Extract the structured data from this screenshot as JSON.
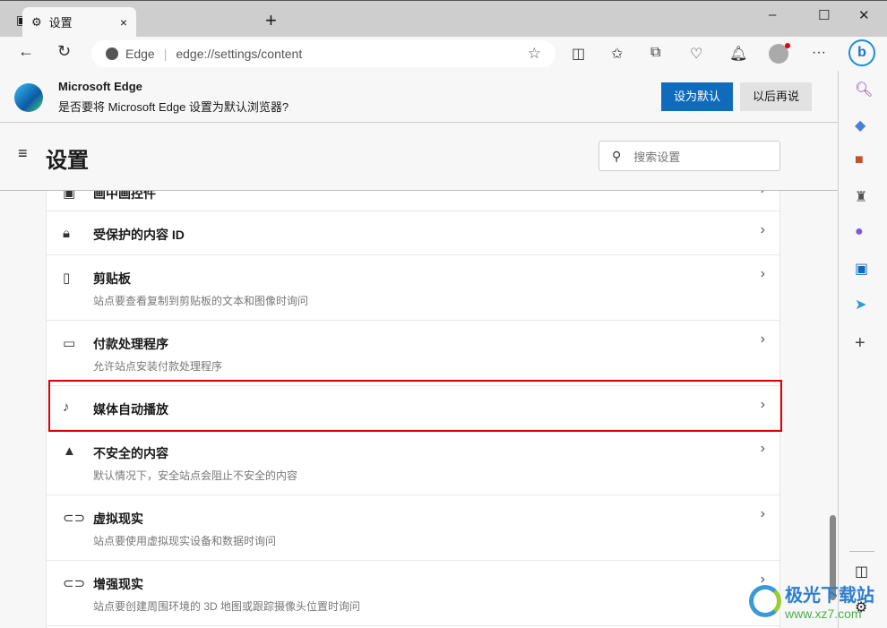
{
  "tab": {
    "title": "设置",
    "close": "×",
    "new": "+"
  },
  "window": {
    "min": "–",
    "max": "☐",
    "close": "✕"
  },
  "address": {
    "site": "Edge",
    "url": "edge://settings/content"
  },
  "banner": {
    "title": "Microsoft Edge",
    "message": "是否要将 Microsoft Edge 设置为默认浏览器?",
    "primary": "设为默认",
    "secondary": "以后再说",
    "accent": "#0f6cbd"
  },
  "header": {
    "title": "设置",
    "search_placeholder": "搜索设置"
  },
  "rows": [
    {
      "title": "画中画控件",
      "desc": ""
    },
    {
      "title": "受保护的内容 ID",
      "desc": ""
    },
    {
      "title": "剪贴板",
      "desc": "站点要查看复制到剪贴板的文本和图像时询问"
    },
    {
      "title": "付款处理程序",
      "desc": "允许站点安装付款处理程序"
    },
    {
      "title": "媒体自动播放",
      "desc": "",
      "highlighted": true
    },
    {
      "title": "不安全的内容",
      "desc": "默认情况下，安全站点会阻止不安全的内容"
    },
    {
      "title": "虚拟现实",
      "desc": "站点要使用虚拟现实设备和数据时询问"
    },
    {
      "title": "增强现实",
      "desc": "站点要创建周围环境的 3D 地图或跟踪摄像头位置时询问"
    }
  ],
  "watermark": {
    "name": "极光下载站",
    "url": "www.xz7.com"
  },
  "highlight_color": "#e00000"
}
